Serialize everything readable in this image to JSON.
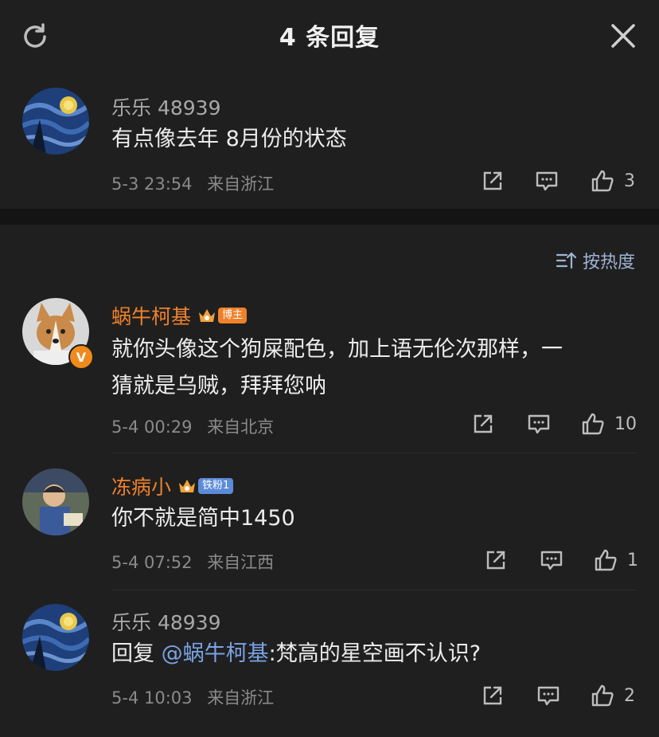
{
  "header": {
    "title": "4 条回复",
    "refresh_icon": "refresh-icon",
    "close_icon": "close-icon"
  },
  "root_comment": {
    "user": "乐乐 48939",
    "text": "有点像去年 8月份的状态",
    "time": "5-3 23:54",
    "location": "来自浙江",
    "likes": "3"
  },
  "sort": {
    "label": "按热度"
  },
  "replies": [
    {
      "user": "蜗牛柯基",
      "badge": "博主",
      "text_line1": "就你头像这个狗屎配色，加上语无伦次那样，一",
      "text_line2": "猜就是乌贼，拜拜您呐",
      "verified": "V",
      "time": "5-4 00:29",
      "location": "来自北京",
      "likes": "10"
    },
    {
      "user": "冻病小",
      "badge": "铁粉1",
      "text": "你不就是简中1450",
      "time": "5-4 07:52",
      "location": "来自江西",
      "likes": "1"
    },
    {
      "user": "乐乐 48939",
      "reply_prefix": "回复 ",
      "mention": "@蜗牛柯基",
      "reply_text": ":梵高的星空画不认识?",
      "time": "5-4 10:03",
      "location": "来自浙江",
      "likes": "2"
    }
  ],
  "colors": {
    "accent_orange": "#f0812a",
    "mention_blue": "#7aa2e3",
    "background": "#1f1f1f"
  }
}
